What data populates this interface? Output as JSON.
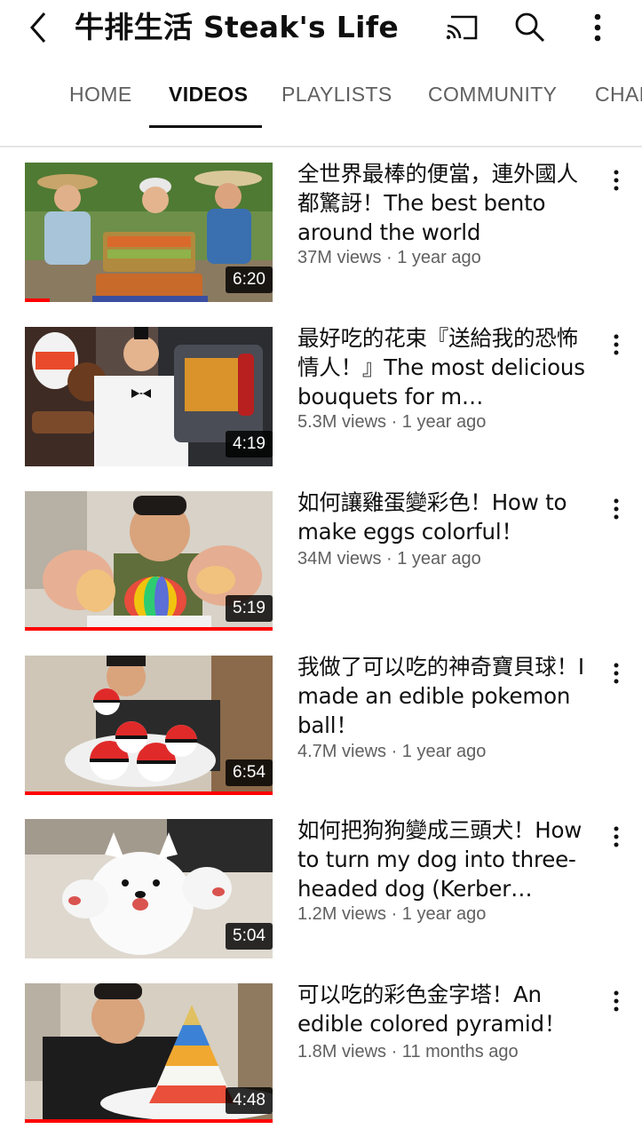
{
  "header": {
    "channel_title": "牛排生活 Steak's Life",
    "icons": [
      "back-arrow-icon",
      "cast-icon",
      "search-icon",
      "more-vert-icon"
    ]
  },
  "tabs": [
    {
      "label": "HOME",
      "active": false
    },
    {
      "label": "VIDEOS",
      "active": true
    },
    {
      "label": "PLAYLISTS",
      "active": false
    },
    {
      "label": "COMMUNITY",
      "active": false
    },
    {
      "label": "CHANNELS",
      "active": false
    }
  ],
  "videos": [
    {
      "title": "全世界最棒的便當，連外國人都驚訝！The best bento around the world",
      "meta": "37M views · 1 year ago",
      "duration": "6:20",
      "watched": 0.1
    },
    {
      "title": "最好吃的花束『送給我的恐怖情人！』The most delicious bouquets for m…",
      "meta": "5.3M views · 1 year ago",
      "duration": "4:19",
      "watched": 0.0
    },
    {
      "title": "如何讓雞蛋變彩色！How to make eggs colorful！",
      "meta": "34M views · 1 year ago",
      "duration": "5:19",
      "watched": 1.0
    },
    {
      "title": "我做了可以吃的神奇寶貝球！I made an edible pokemon ball！",
      "meta": "4.7M views · 1 year ago",
      "duration": "6:54",
      "watched": 1.0
    },
    {
      "title": "如何把狗狗變成三頭犬！How to turn my dog into three-headed dog (Kerber…",
      "meta": "1.2M views · 1 year ago",
      "duration": "5:04",
      "watched": 0.0
    },
    {
      "title": "可以吃的彩色金字塔！An edible colored pyramid！",
      "meta": "1.8M views · 11 months ago",
      "duration": "4:48",
      "watched": 1.0
    }
  ],
  "colors": {
    "progress": "#ff0000",
    "text_primary": "#0f0f0f",
    "text_secondary": "#606060"
  }
}
